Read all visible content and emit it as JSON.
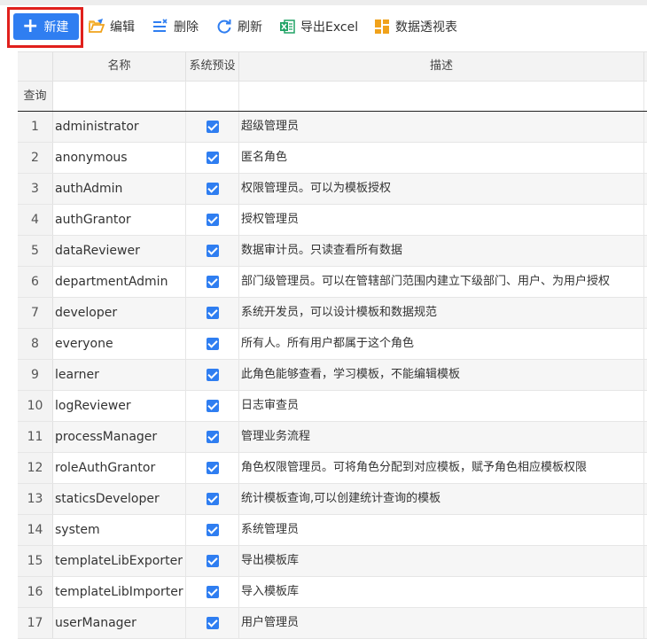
{
  "toolbar": {
    "new_label": "新建",
    "edit_label": "编辑",
    "delete_label": "删除",
    "refresh_label": "刷新",
    "export_label": "导出Excel",
    "pivot_label": "数据透视表"
  },
  "columns": {
    "name": "名称",
    "system": "系统预设",
    "desc": "描述"
  },
  "filter_label": "查询",
  "colors": {
    "accent": "#2f7ef1",
    "highlight_border": "#e0201c"
  },
  "rows": [
    {
      "num": "1",
      "name": "administrator",
      "system": true,
      "desc": "超级管理员"
    },
    {
      "num": "2",
      "name": "anonymous",
      "system": true,
      "desc": "匿名角色"
    },
    {
      "num": "3",
      "name": "authAdmin",
      "system": true,
      "desc": "权限管理员。可以为模板授权"
    },
    {
      "num": "4",
      "name": "authGrantor",
      "system": true,
      "desc": "授权管理员"
    },
    {
      "num": "5",
      "name": "dataReviewer",
      "system": true,
      "desc": "数据审计员。只读查看所有数据"
    },
    {
      "num": "6",
      "name": "departmentAdmin",
      "system": true,
      "desc": "部门级管理员。可以在管辖部门范围内建立下级部门、用户、为用户授权"
    },
    {
      "num": "7",
      "name": "developer",
      "system": true,
      "desc": "系统开发员，可以设计模板和数据规范"
    },
    {
      "num": "8",
      "name": "everyone",
      "system": true,
      "desc": "所有人。所有用户都属于这个角色"
    },
    {
      "num": "9",
      "name": "learner",
      "system": true,
      "desc": "此角色能够查看，学习模板，不能编辑模板"
    },
    {
      "num": "10",
      "name": "logReviewer",
      "system": true,
      "desc": "日志审查员"
    },
    {
      "num": "11",
      "name": "processManager",
      "system": true,
      "desc": "管理业务流程"
    },
    {
      "num": "12",
      "name": "roleAuthGrantor",
      "system": true,
      "desc": "角色权限管理员。可将角色分配到对应模板，赋予角色相应模板权限"
    },
    {
      "num": "13",
      "name": "staticsDeveloper",
      "system": true,
      "desc": "统计模板查询,可以创建统计查询的模板"
    },
    {
      "num": "14",
      "name": "system",
      "system": true,
      "desc": "系统管理员"
    },
    {
      "num": "15",
      "name": "templateLibExporter",
      "system": true,
      "desc": "导出模板库"
    },
    {
      "num": "16",
      "name": "templateLibImporter",
      "system": true,
      "desc": "导入模板库"
    },
    {
      "num": "17",
      "name": "userManager",
      "system": true,
      "desc": "用户管理员"
    }
  ]
}
